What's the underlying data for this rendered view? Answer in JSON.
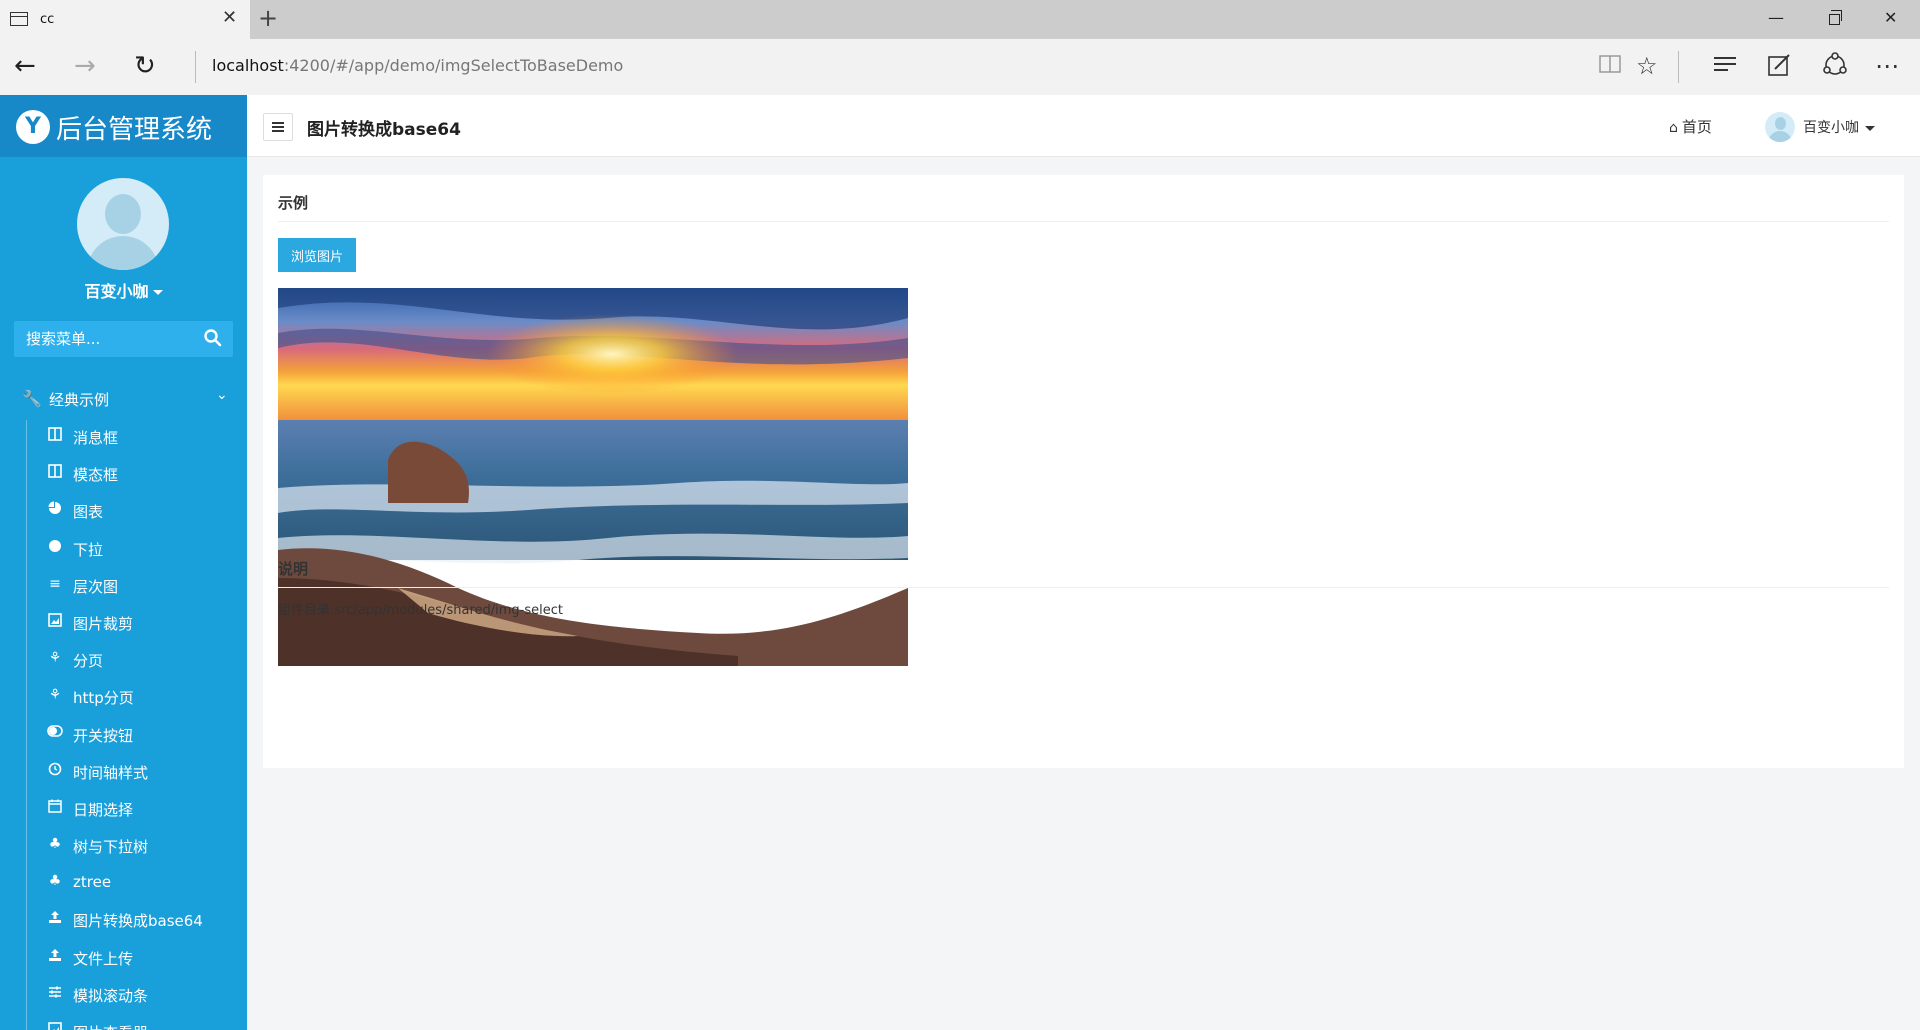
{
  "browser": {
    "tab_title": "cc",
    "url_host": "localhost",
    "url_rest": ":4200/#/app/demo/imgSelectToBaseDemo"
  },
  "app": {
    "brand": "后台管理系统",
    "user_name": "百变小咖",
    "search_placeholder": "搜索菜单...",
    "menu_group": "经典示例",
    "menu_items": [
      {
        "label": "消息框",
        "icon": "columns-icon"
      },
      {
        "label": "模态框",
        "icon": "columns-icon"
      },
      {
        "label": "图表",
        "icon": "pie-chart-icon"
      },
      {
        "label": "下拉",
        "icon": "circle-icon"
      },
      {
        "label": "层次图",
        "icon": "layers-icon"
      },
      {
        "label": "图片裁剪",
        "icon": "image-icon"
      },
      {
        "label": "分页",
        "icon": "tree-icon"
      },
      {
        "label": "http分页",
        "icon": "tree-icon"
      },
      {
        "label": "开关按钮",
        "icon": "toggle-icon"
      },
      {
        "label": "时间轴样式",
        "icon": "clock-icon"
      },
      {
        "label": "日期选择",
        "icon": "calendar-icon"
      },
      {
        "label": "树与下拉树",
        "icon": "tree-icon"
      },
      {
        "label": "ztree",
        "icon": "tree-icon"
      },
      {
        "label": "图片转换成base64",
        "icon": "upload-icon"
      },
      {
        "label": "文件上传",
        "icon": "upload-icon"
      },
      {
        "label": "模拟滚动条",
        "icon": "sliders-icon"
      },
      {
        "label": "图片查看器",
        "icon": "image-icon"
      }
    ]
  },
  "header": {
    "title": "图片转换成base64",
    "home": "首页",
    "user_name": "百变小咖"
  },
  "content": {
    "example_title": "示例",
    "browse_label": "浏览图片",
    "desc_title": "说明",
    "desc_text": "组件目录:src/app/modules/shared/img-select"
  },
  "colors": {
    "sidebar": "#199fda",
    "brand_bar": "#1789c9",
    "button": "#2ba8e0",
    "page_bg": "#f4f5f7"
  }
}
